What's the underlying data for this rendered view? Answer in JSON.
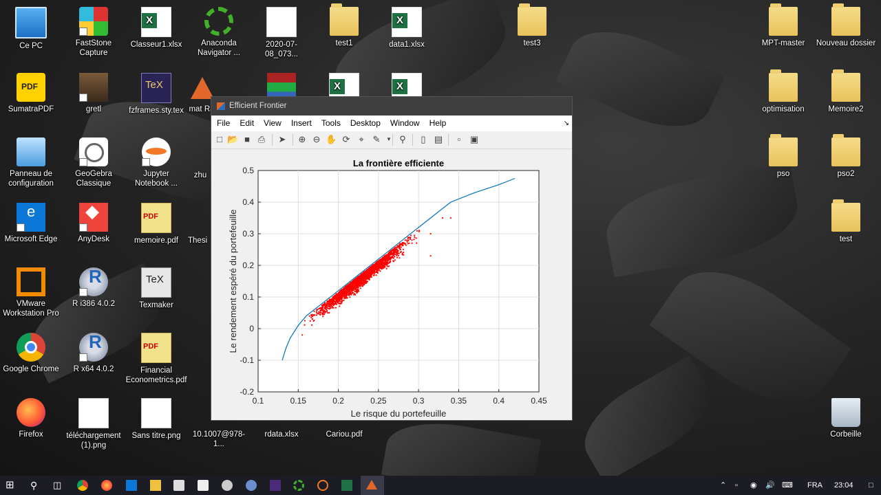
{
  "desktop": {
    "icons": [
      {
        "label": "Ce PC"
      },
      {
        "label": "FastStone Capture"
      },
      {
        "label": "Classeur1.xlsx"
      },
      {
        "label": "Anaconda Navigator ..."
      },
      {
        "label": "2020-07-08_073..."
      },
      {
        "label": "test1"
      },
      {
        "label": "data1.xlsx"
      },
      {
        "label": "test3"
      },
      {
        "label": "MPT-master"
      },
      {
        "label": "Nouveau dossier"
      },
      {
        "label": "SumatraPDF"
      },
      {
        "label": "gretl"
      },
      {
        "label": "fzframes.sty.tex"
      },
      {
        "label": "mat Ra"
      },
      {
        "label": "optimisation"
      },
      {
        "label": "Memoire2"
      },
      {
        "label": "Panneau de configuration"
      },
      {
        "label": "GeoGebra Classique"
      },
      {
        "label": "Jupyter Notebook ..."
      },
      {
        "label": "zhu"
      },
      {
        "label": "pso"
      },
      {
        "label": "pso2"
      },
      {
        "label": "Microsoft Edge"
      },
      {
        "label": "AnyDesk"
      },
      {
        "label": "memoire.pdf"
      },
      {
        "label": "Thesi"
      },
      {
        "label": "test"
      },
      {
        "label": "VMware Workstation Pro"
      },
      {
        "label": "R i386 4.0.2"
      },
      {
        "label": "Texmaker"
      },
      {
        "label": "Google Chrome"
      },
      {
        "label": "R x64 4.0.2"
      },
      {
        "label": "Financial Econometrics.pdf"
      },
      {
        "label": "Firefox"
      },
      {
        "label": "téléchargement (1).png"
      },
      {
        "label": "Sans titre.png"
      },
      {
        "label": "10.1007@978-1..."
      },
      {
        "label": "rdata.xlsx"
      },
      {
        "label": "Cariou.pdf"
      },
      {
        "label": "Corbeille"
      }
    ]
  },
  "window": {
    "title": "Efficient Frontier",
    "menu": [
      "File",
      "Edit",
      "View",
      "Insert",
      "Tools",
      "Desktop",
      "Window",
      "Help"
    ],
    "dock_glyph": "↘"
  },
  "toolbar": {
    "icons": [
      "new-figure-icon",
      "open-file-icon",
      "save-icon",
      "print-icon",
      "pointer-icon",
      "zoom-in-icon",
      "zoom-out-icon",
      "pan-icon",
      "rotate-icon",
      "data-cursor-icon",
      "brush-icon",
      "link-icon",
      "insert-colorbar-icon",
      "insert-legend-icon",
      "hide-plot-tools-icon",
      "show-plot-tools-icon"
    ]
  },
  "chart_data": {
    "type": "scatter",
    "title": "La frontière efficiente",
    "xlabel": "Le risque du portefeuille",
    "ylabel": "Le rendement espéré du portefeuille",
    "xlim": [
      0.1,
      0.45
    ],
    "ylim": [
      -0.2,
      0.5
    ],
    "x_ticks": [
      "0.1",
      "0.15",
      "0.2",
      "0.25",
      "0.3",
      "0.35",
      "0.4",
      "0.45"
    ],
    "y_ticks": [
      "-0.2",
      "-0.1",
      "0",
      "0.1",
      "0.2",
      "0.3",
      "0.4",
      "0.5"
    ],
    "grid": true,
    "series": [
      {
        "kind": "line",
        "color": "#0072bd",
        "x": [
          0.13,
          0.135,
          0.14,
          0.15,
          0.16,
          0.18,
          0.2,
          0.22,
          0.25,
          0.28,
          0.31,
          0.34,
          0.37,
          0.4,
          0.42
        ],
        "y": [
          -0.1,
          -0.06,
          -0.03,
          0.01,
          0.04,
          0.08,
          0.12,
          0.16,
          0.22,
          0.28,
          0.34,
          0.4,
          0.43,
          0.455,
          0.475
        ]
      },
      {
        "kind": "scatter",
        "color": "#ff0000",
        "cloud": {
          "x_range": [
            0.15,
            0.34
          ],
          "y_range": [
            -0.03,
            0.35
          ],
          "center": [
            0.23,
            0.15
          ]
        }
      }
    ]
  },
  "taskbar": {
    "tray": {
      "language": "FRA",
      "time": "23:04"
    }
  }
}
